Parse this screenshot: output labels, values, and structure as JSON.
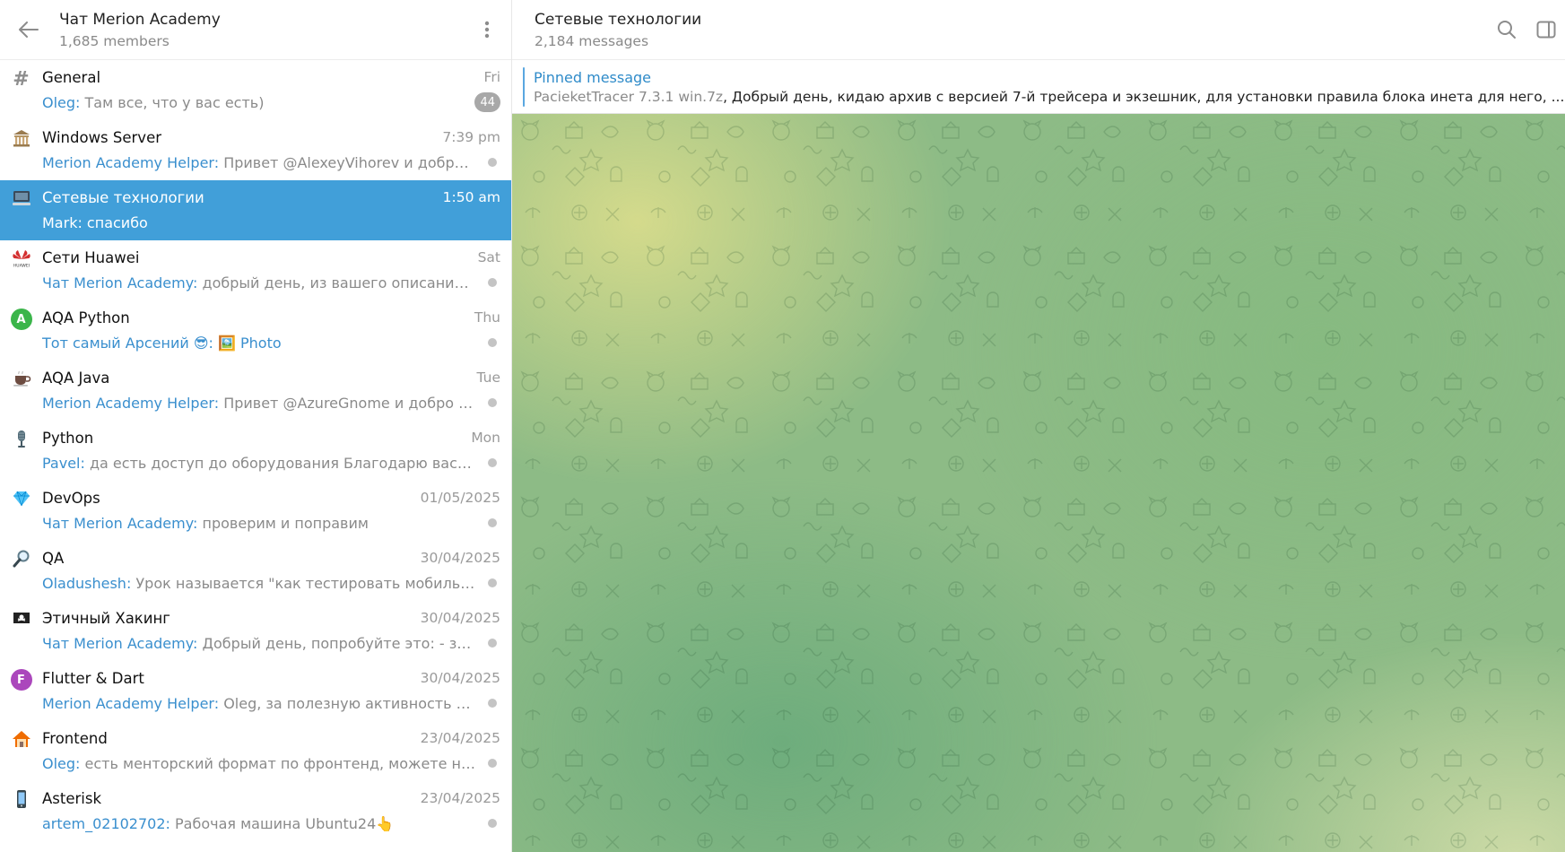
{
  "sidebar": {
    "title": "Чат Merion Academy",
    "subtitle": "1,685 members",
    "topics": [
      {
        "name": "General",
        "time": "Fri",
        "sender": "Oleg:",
        "preview": " Там все, что у вас есть)",
        "badge": "44",
        "icon": "hash-icon"
      },
      {
        "name": "Windows Server",
        "time": "7:39 pm",
        "sender": "Merion Academy Helper:",
        "preview": " Привет @AlexeyVihorev и добро по...",
        "icon": "classical-building-icon"
      },
      {
        "name": "Сетевые технологии",
        "time": "1:50 am",
        "sender": "Mark:",
        "preview": " спасибо",
        "icon": "computer-icon",
        "active": true
      },
      {
        "name": "Сети Huawei",
        "time": "Sat",
        "sender": "Чат Merion Academy:",
        "preview": " добрый день, из вашего описания не ...",
        "icon": "huawei-logo-icon"
      },
      {
        "name": "AQA Python",
        "time": "Thu",
        "sender": "Тот самый Арсений 😎:",
        "preview": " 🖼️ Photo",
        "icon": "letter-a-icon"
      },
      {
        "name": "AQA Java",
        "time": "Tue",
        "sender": "Merion Academy Helper:",
        "preview": " Привет @AzureGnome и добро пож...",
        "icon": "coffee-icon"
      },
      {
        "name": "Python",
        "time": "Mon",
        "sender": "Pavel:",
        "preview": " да есть доступ до оборудования Благодарю вас! Попр...",
        "icon": "microphone-icon"
      },
      {
        "name": "DevOps",
        "time": "01/05/2025",
        "sender": "Чат Merion Academy:",
        "preview": " проверим и поправим",
        "icon": "diamond-icon"
      },
      {
        "name": "QA",
        "time": "30/04/2025",
        "sender": "Oladushesh:",
        "preview": " Урок называется \"как тестировать мобильные ...",
        "icon": "magnifier-icon"
      },
      {
        "name": "Этичный Хакинг",
        "time": "30/04/2025",
        "sender": "Чат Merion Academy:",
        "preview": " Добрый день, попробуйте это:  - запус...",
        "icon": "pirate-flag-icon"
      },
      {
        "name": "Flutter & Dart",
        "time": "30/04/2025",
        "sender": "Merion Academy Helper:",
        "preview": " Oleg, за полезную активность ты по...",
        "icon": "letter-f-icon"
      },
      {
        "name": "Frontend",
        "time": "23/04/2025",
        "sender": "Oleg:",
        "preview": " есть менторский формат по фронтенд, можете написа...",
        "icon": "house-icon"
      },
      {
        "name": "Asterisk",
        "time": "23/04/2025",
        "sender": "artem_02102702:",
        "preview": " Рабочая машина Ubuntu24👆",
        "icon": "phone-icon"
      }
    ]
  },
  "main": {
    "title": "Сетевые технологии",
    "subtitle": "2,184 messages",
    "pinned": {
      "label": "Pinned message",
      "file": "PacieketTracer 7.3.1 win.7z",
      "text": ", Добрый день, кидаю архив с версией 7-й трейсера и экзешник, для установки правила блока инета для него, ..."
    }
  },
  "colors": {
    "accent": "#419fd9",
    "link": "#3a8fce"
  }
}
